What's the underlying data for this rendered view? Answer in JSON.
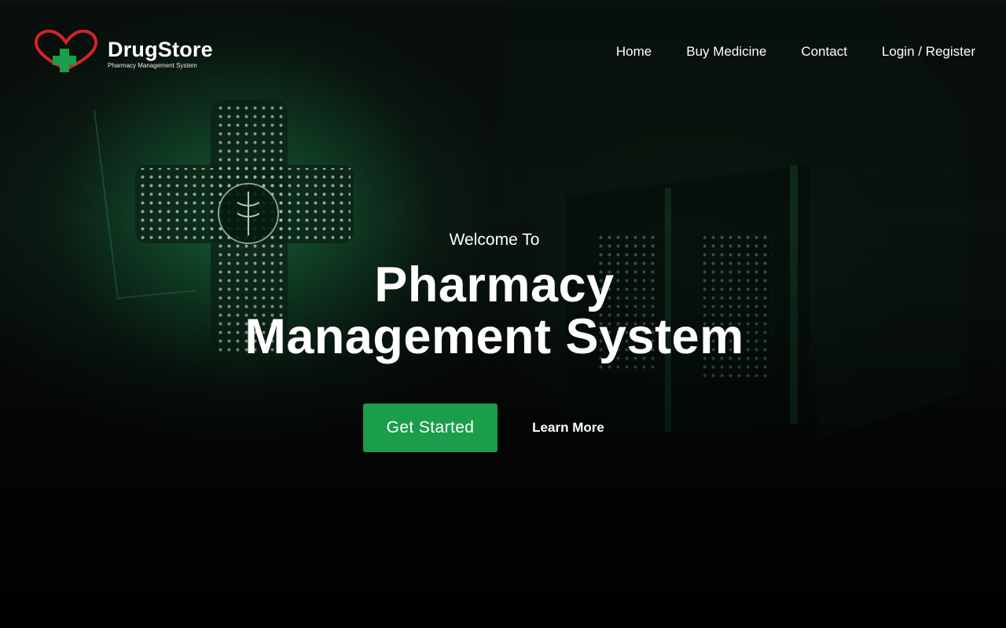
{
  "brand": {
    "name": "DrugStore",
    "tagline": "Pharmacy Management System",
    "colors": {
      "heart": "#d1232a",
      "cross": "#1a9e4b"
    }
  },
  "nav": {
    "items": [
      {
        "label": "Home"
      },
      {
        "label": "Buy Medicine"
      },
      {
        "label": "Contact"
      },
      {
        "label": "Login / Register"
      }
    ]
  },
  "hero": {
    "welcome": "Welcome To",
    "title_line1": "Pharmacy",
    "title_line2": "Management System",
    "primary_button": "Get Started",
    "secondary_button": "Learn More",
    "accent_color": "#1a9e4b"
  }
}
